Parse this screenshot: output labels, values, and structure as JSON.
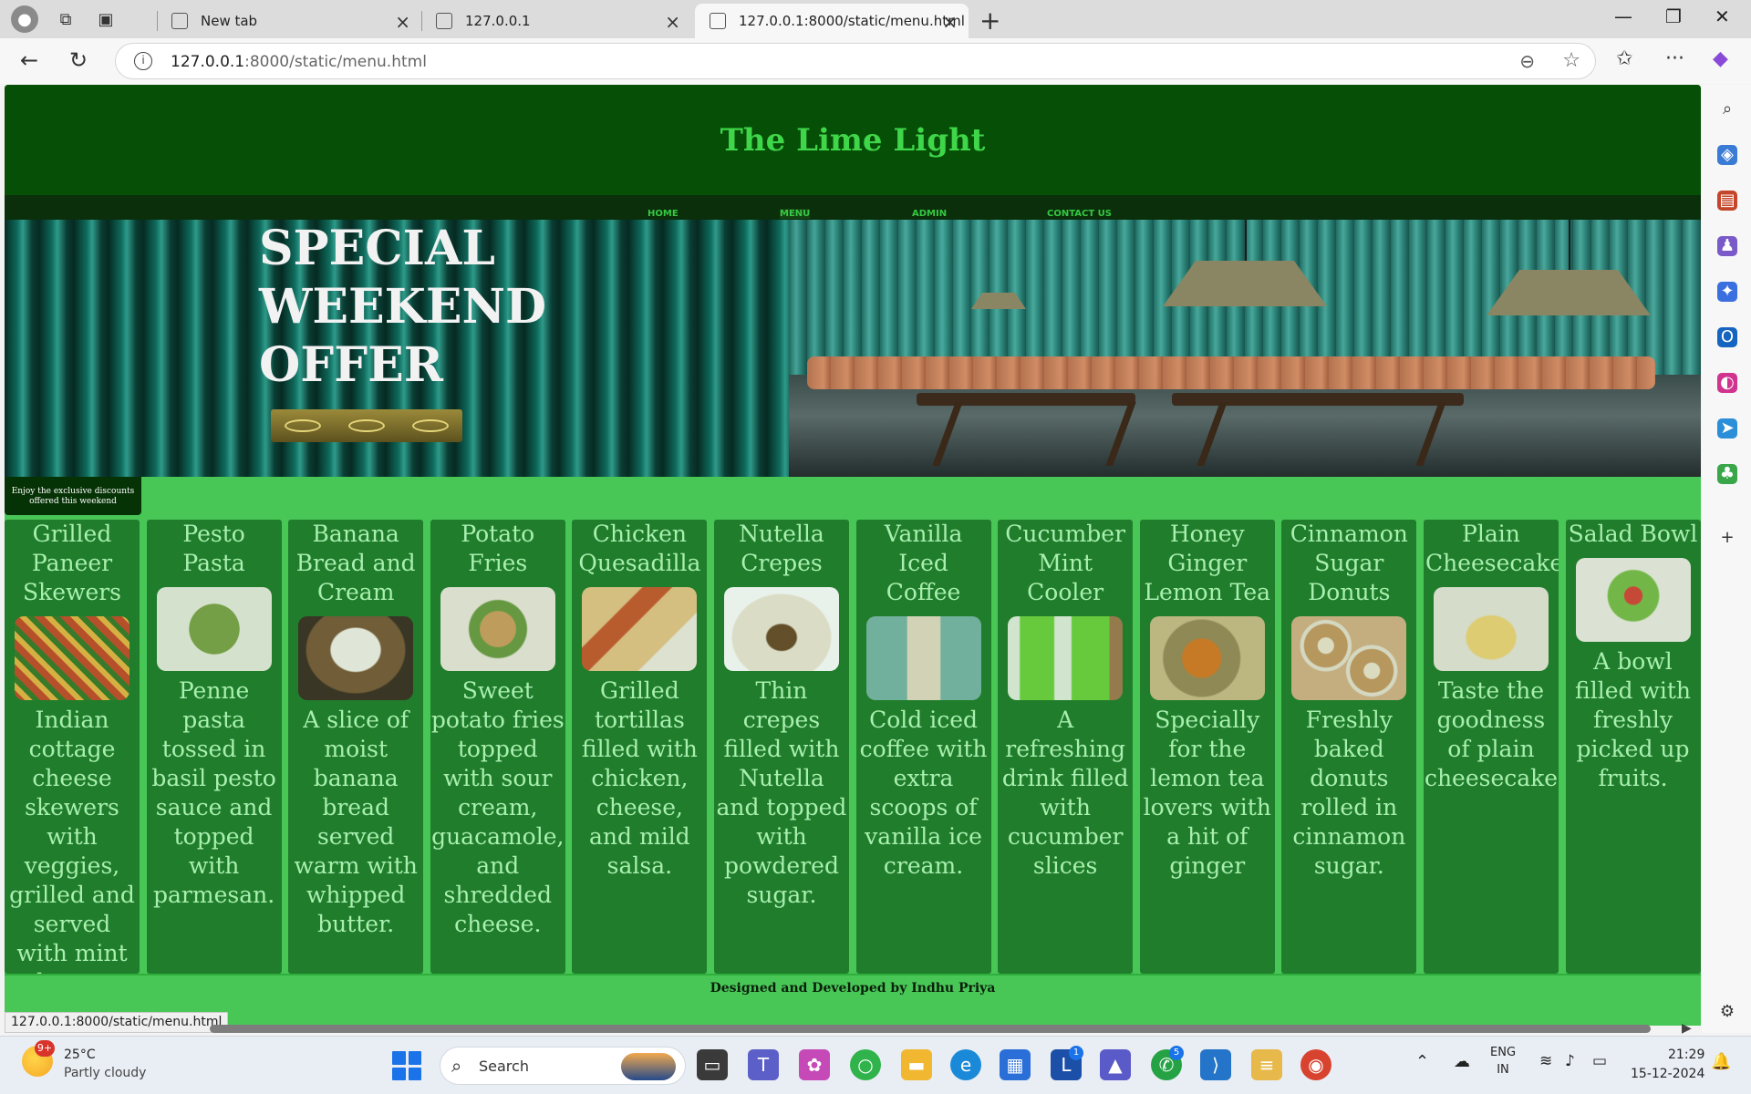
{
  "browser": {
    "tabs": [
      {
        "title": "New tab"
      },
      {
        "title": "127.0.0.1"
      },
      {
        "title": "127.0.0.1:8000/static/menu.html"
      }
    ],
    "url_host": "127.0.0.1",
    "url_rest": ":8000/static/menu.html",
    "status_url": "127.0.0.1:8000/static/menu.html"
  },
  "site": {
    "title": "The Lime Light",
    "nav": [
      {
        "label": "HOME"
      },
      {
        "label": "MENU"
      },
      {
        "label": "ADMIN"
      },
      {
        "label": "CONTACT US"
      }
    ],
    "hero": {
      "lines": [
        "SPECIAL",
        "WEEKEND",
        "OFFER"
      ]
    },
    "tooltip": "Enjoy the exclusive discounts offered this weekend",
    "items": [
      {
        "name": "Grilled Paneer Skewers",
        "desc": "Indian cottage cheese skewers with veggies, grilled and served with mint chutney."
      },
      {
        "name": "Pesto Pasta",
        "desc": "Penne pasta tossed in basil pesto sauce and topped with parmesan."
      },
      {
        "name": "Banana Bread and Cream",
        "desc": "A slice of moist banana bread served warm with whipped butter."
      },
      {
        "name": "Potato Fries",
        "desc": "Sweet potato fries topped with sour cream, guacamole, and shredded cheese."
      },
      {
        "name": "Chicken Quesadilla",
        "desc": "Grilled tortillas filled with chicken, cheese, and mild salsa."
      },
      {
        "name": "Nutella Crepes",
        "desc": "Thin crepes filled with Nutella and topped with powdered sugar."
      },
      {
        "name": "Vanilla Iced Coffee",
        "desc": "Cold iced coffee with extra scoops of vanilla ice cream."
      },
      {
        "name": "Cucumber Mint Cooler",
        "desc": "A refreshing drink filled with cucumber slices"
      },
      {
        "name": "Honey Ginger Lemon Tea",
        "desc": "Specially for the lemon tea lovers with a hit of ginger"
      },
      {
        "name": "Cinnamon Sugar Donuts",
        "desc": "Freshly baked donuts rolled in cinnamon sugar."
      },
      {
        "name": "Plain Cheesecake",
        "desc": "Taste the goodness of plain cheesecake"
      },
      {
        "name": "Salad Bowl",
        "desc": "A bowl filled with freshly picked up fruits."
      }
    ],
    "footer": "Designed and Developed by Indhu Priya"
  },
  "taskbar": {
    "weather_badge": "9+",
    "temperature": "25°C",
    "condition": "Partly cloudy",
    "search_label": "Search",
    "lang_top": "ENG",
    "lang_bottom": "IN",
    "time": "21:29",
    "date": "15-12-2024",
    "badge_l": "1",
    "badge_whatsapp": "5"
  }
}
